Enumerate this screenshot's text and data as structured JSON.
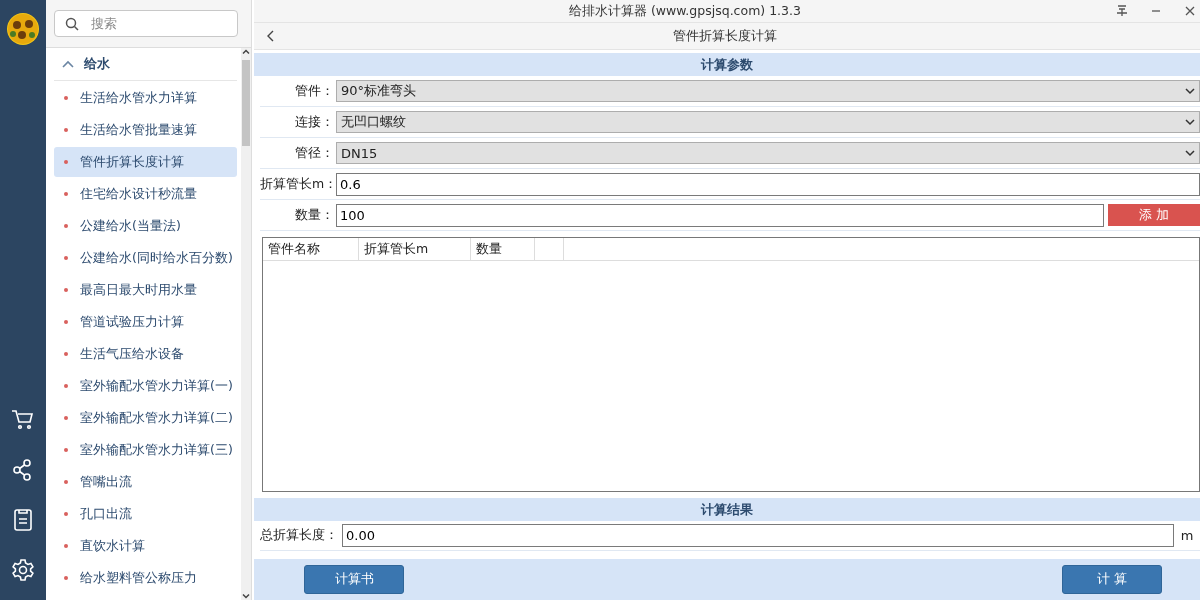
{
  "window": {
    "title": "给排水计算器 (www.gpsjsq.com) 1.3.3"
  },
  "sidebar": {
    "search": {
      "placeholder": "搜索"
    },
    "groups": [
      {
        "label": "给水",
        "expanded": true,
        "items": [
          {
            "label": "生活给水管水力详算",
            "selected": false
          },
          {
            "label": "生活给水管批量速算",
            "selected": false
          },
          {
            "label": "管件折算长度计算",
            "selected": true
          },
          {
            "label": "住宅给水设计秒流量",
            "selected": false
          },
          {
            "label": "公建给水(当量法)",
            "selected": false
          },
          {
            "label": "公建给水(同时给水百分数)",
            "selected": false
          },
          {
            "label": "最高日最大时用水量",
            "selected": false
          },
          {
            "label": "管道试验压力计算",
            "selected": false
          },
          {
            "label": "生活气压给水设备",
            "selected": false
          },
          {
            "label": "室外输配水管水力详算(一)",
            "selected": false
          },
          {
            "label": "室外输配水管水力详算(二)",
            "selected": false
          },
          {
            "label": "室外输配水管水力详算(三)",
            "selected": false
          },
          {
            "label": "管嘴出流",
            "selected": false
          },
          {
            "label": "孔口出流",
            "selected": false
          },
          {
            "label": "直饮水计算",
            "selected": false
          },
          {
            "label": "给水塑料管公称压力",
            "selected": false
          }
        ]
      }
    ]
  },
  "page": {
    "title": "管件折算长度计算"
  },
  "params": {
    "title": "计算参数",
    "fields": [
      {
        "kind": "select",
        "label": "管件：",
        "value": "90°标准弯头"
      },
      {
        "kind": "select",
        "label": "连接：",
        "value": "无凹口螺纹"
      },
      {
        "kind": "select",
        "label": "管径：",
        "value": "DN15"
      },
      {
        "kind": "input",
        "label": "折算管长m：",
        "value": "0.6"
      },
      {
        "kind": "input",
        "label": "数量：",
        "value": "100",
        "button": "添 加"
      }
    ],
    "table": {
      "columns": [
        "管件名称",
        "折算管长m",
        "数量"
      ]
    }
  },
  "result": {
    "title": "计算结果",
    "label": "总折算长度：",
    "value": "0.00",
    "unit": "m"
  },
  "buttons": [
    "计算书",
    "计 算"
  ]
}
